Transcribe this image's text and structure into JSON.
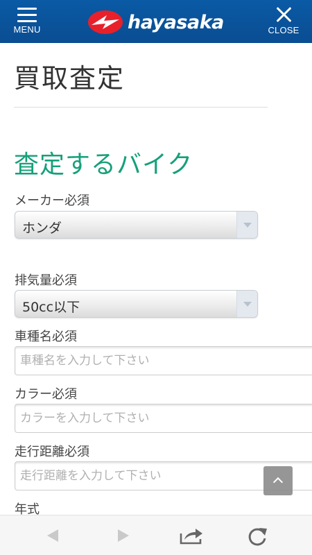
{
  "header": {
    "menu_label": "MENU",
    "close_label": "CLOSE",
    "logo_text": "hayasaka",
    "color": "#0a52a0"
  },
  "page": {
    "title": "買取査定",
    "section_title": "査定するバイク",
    "accent_color": "#16a07a"
  },
  "form": {
    "maker": {
      "label": "メーカー必須",
      "value": "ホンダ"
    },
    "displacement": {
      "label": "排気量必須",
      "value": "50cc以下"
    },
    "model_name": {
      "label": "車種名必須",
      "placeholder": "車種名を入力して下さい"
    },
    "color": {
      "label": "カラー必須",
      "placeholder": "カラーを入力して下さい"
    },
    "mileage": {
      "label": "走行距離必須",
      "placeholder": "走行距離を入力して下さい"
    },
    "year": {
      "label": "年式"
    }
  },
  "icons": {
    "menu": "hamburger-icon",
    "close": "close-icon",
    "logo": "hayasaka-logo",
    "scroll_top": "chevron-up-icon",
    "back": "back-arrow-icon",
    "forward": "forward-arrow-icon",
    "share": "share-icon",
    "reload": "reload-icon"
  }
}
